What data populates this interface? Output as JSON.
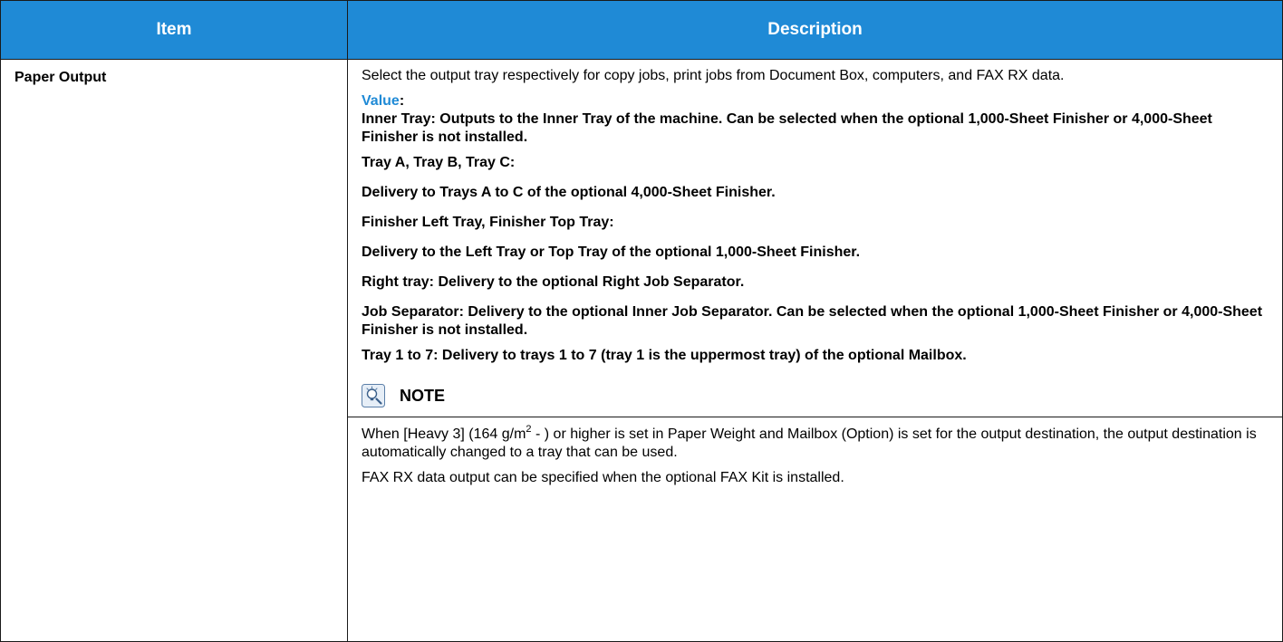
{
  "table": {
    "headers": {
      "item": "Item",
      "description": "Description"
    },
    "row": {
      "item": "Paper Output",
      "intro": "Select the output tray respectively for copy jobs, print jobs from Document Box, computers, and FAX RX data.",
      "value_label": "Value",
      "value_colon": ":",
      "values": [
        "Inner Tray: Outputs to the Inner Tray of the machine. Can be selected when the optional 1,000-Sheet Finisher or 4,000-Sheet Finisher is not installed.",
        "Tray A, Tray B, Tray C:",
        "Delivery to Trays A to C of the optional 4,000-Sheet Finisher.",
        "Finisher Left Tray, Finisher Top Tray:",
        "Delivery to the Left Tray or Top Tray of the optional 1,000-Sheet Finisher.",
        "Right tray: Delivery to the optional Right Job Separator.",
        "Job Separator: Delivery to the optional Inner Job Separator. Can be selected when the optional 1,000-Sheet Finisher or 4,000-Sheet Finisher is not installed.",
        "Tray 1 to 7: Delivery to trays 1 to 7 (tray 1 is the uppermost tray) of the optional Mailbox."
      ],
      "note": {
        "icon": "note-lightbulb-icon",
        "label": "NOTE",
        "line1_before": "When [Heavy 3] (164 g/m",
        "line1_sup": "2",
        "line1_after": " - ) or higher is set in Paper Weight and Mailbox (Option) is set for the output destination, the output destination is automatically changed to a tray that can be used.",
        "line2": "FAX RX data output can be specified when the optional FAX Kit is installed."
      }
    }
  },
  "colors": {
    "header_bg": "#1f8ad6",
    "header_text": "#ffffff",
    "value_label": "#1f8ad6",
    "border": "#1a1a1a"
  }
}
